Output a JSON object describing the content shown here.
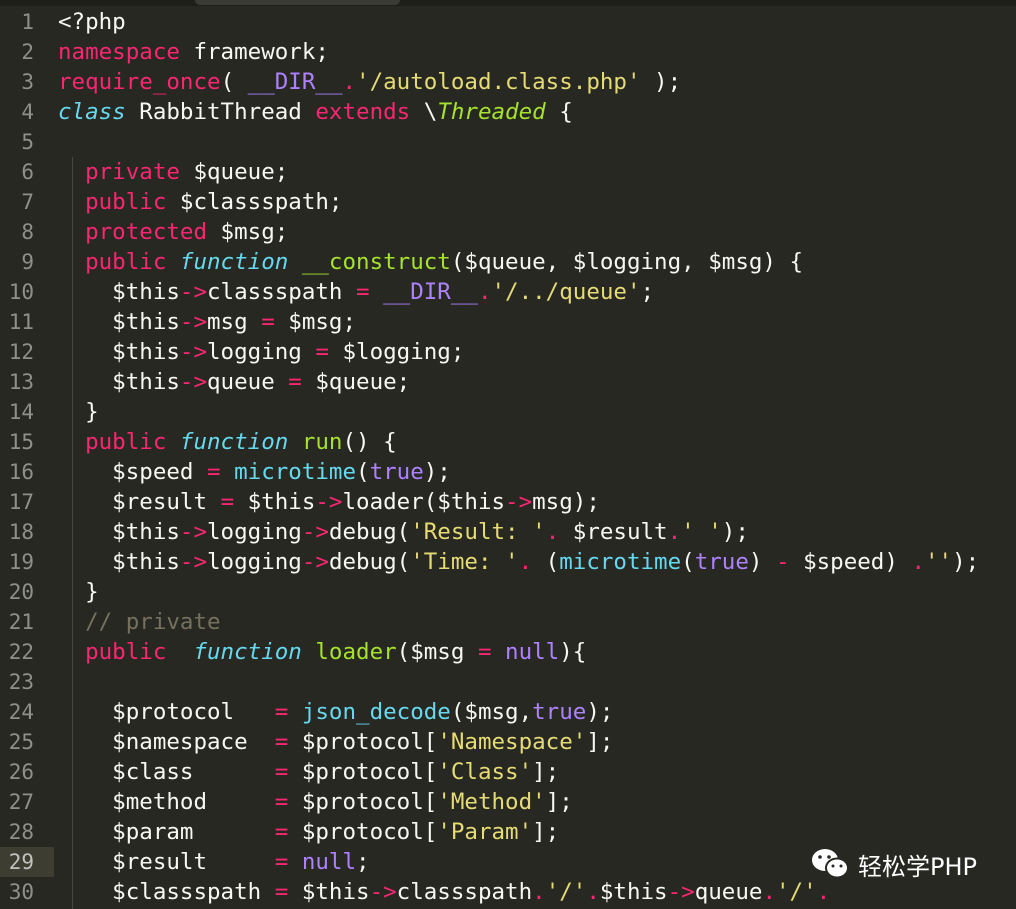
{
  "editor": {
    "theme_colors": {
      "background": "#272822",
      "keyword": "#f92672",
      "string": "#e6db74",
      "constant": "#ae81ff",
      "storage": "#66d9ef",
      "function": "#a6e22e",
      "comment": "#75715e"
    },
    "current_line": 29,
    "lines": [
      [
        [
          "p",
          "<?php"
        ]
      ],
      [
        [
          "k",
          "namespace"
        ],
        [
          "p",
          " framework;"
        ]
      ],
      [
        [
          "k",
          "require_once"
        ],
        [
          "p",
          "( "
        ],
        [
          "c",
          "__DIR__"
        ],
        [
          "k",
          "."
        ],
        [
          "s",
          "'/autoload.class.php'"
        ],
        [
          "p",
          " );"
        ]
      ],
      [
        [
          "i",
          "class"
        ],
        [
          "p",
          " RabbitThread "
        ],
        [
          "k",
          "extends"
        ],
        [
          "p",
          " \\"
        ],
        [
          "g",
          "Threaded"
        ],
        [
          "p",
          " {"
        ]
      ],
      [],
      [
        [
          "p",
          "  "
        ],
        [
          "k",
          "private"
        ],
        [
          "p",
          " $queue;"
        ]
      ],
      [
        [
          "p",
          "  "
        ],
        [
          "k",
          "public"
        ],
        [
          "p",
          " $classspath;"
        ]
      ],
      [
        [
          "p",
          "  "
        ],
        [
          "k",
          "protected"
        ],
        [
          "p",
          " $msg;"
        ]
      ],
      [
        [
          "p",
          "  "
        ],
        [
          "k",
          "public"
        ],
        [
          "p",
          " "
        ],
        [
          "i",
          "function"
        ],
        [
          "p",
          " "
        ],
        [
          "f",
          "__construct"
        ],
        [
          "p",
          "($queue, $logging, $msg) {"
        ]
      ],
      [
        [
          "p",
          "    $this"
        ],
        [
          "k",
          "->"
        ],
        [
          "p",
          "classspath "
        ],
        [
          "k",
          "="
        ],
        [
          "p",
          " "
        ],
        [
          "c",
          "__DIR__"
        ],
        [
          "k",
          "."
        ],
        [
          "s",
          "'/../queue'"
        ],
        [
          "p",
          ";"
        ]
      ],
      [
        [
          "p",
          "    $this"
        ],
        [
          "k",
          "->"
        ],
        [
          "p",
          "msg "
        ],
        [
          "k",
          "="
        ],
        [
          "p",
          " $msg;"
        ]
      ],
      [
        [
          "p",
          "    $this"
        ],
        [
          "k",
          "->"
        ],
        [
          "p",
          "logging "
        ],
        [
          "k",
          "="
        ],
        [
          "p",
          " $logging;"
        ]
      ],
      [
        [
          "p",
          "    $this"
        ],
        [
          "k",
          "->"
        ],
        [
          "p",
          "queue "
        ],
        [
          "k",
          "="
        ],
        [
          "p",
          " $queue;"
        ]
      ],
      [
        [
          "p",
          "  }"
        ]
      ],
      [
        [
          "p",
          "  "
        ],
        [
          "k",
          "public"
        ],
        [
          "p",
          " "
        ],
        [
          "i",
          "function"
        ],
        [
          "p",
          " "
        ],
        [
          "f",
          "run"
        ],
        [
          "p",
          "() {"
        ]
      ],
      [
        [
          "p",
          "    $speed "
        ],
        [
          "k",
          "="
        ],
        [
          "p",
          " "
        ],
        [
          "b",
          "microtime"
        ],
        [
          "p",
          "("
        ],
        [
          "c",
          "true"
        ],
        [
          "p",
          ");"
        ]
      ],
      [
        [
          "p",
          "    $result "
        ],
        [
          "k",
          "="
        ],
        [
          "p",
          " $this"
        ],
        [
          "k",
          "->"
        ],
        [
          "p",
          "loader($this"
        ],
        [
          "k",
          "->"
        ],
        [
          "p",
          "msg);"
        ]
      ],
      [
        [
          "p",
          "    $this"
        ],
        [
          "k",
          "->"
        ],
        [
          "p",
          "logging"
        ],
        [
          "k",
          "->"
        ],
        [
          "p",
          "debug("
        ],
        [
          "s",
          "'Result: '"
        ],
        [
          "k",
          "."
        ],
        [
          "p",
          " $result"
        ],
        [
          "k",
          "."
        ],
        [
          "s",
          "' '"
        ],
        [
          "p",
          ");"
        ]
      ],
      [
        [
          "p",
          "    $this"
        ],
        [
          "k",
          "->"
        ],
        [
          "p",
          "logging"
        ],
        [
          "k",
          "->"
        ],
        [
          "p",
          "debug("
        ],
        [
          "s",
          "'Time: '"
        ],
        [
          "k",
          "."
        ],
        [
          "p",
          " ("
        ],
        [
          "b",
          "microtime"
        ],
        [
          "p",
          "("
        ],
        [
          "c",
          "true"
        ],
        [
          "p",
          ") "
        ],
        [
          "k",
          "-"
        ],
        [
          "p",
          " $speed) "
        ],
        [
          "k",
          "."
        ],
        [
          "s",
          "''"
        ],
        [
          "p",
          ");"
        ]
      ],
      [
        [
          "p",
          "  }"
        ]
      ],
      [
        [
          "p",
          "  "
        ],
        [
          "m",
          "// private"
        ]
      ],
      [
        [
          "p",
          "  "
        ],
        [
          "k",
          "public"
        ],
        [
          "p",
          "  "
        ],
        [
          "i",
          "function"
        ],
        [
          "p",
          " "
        ],
        [
          "f",
          "loader"
        ],
        [
          "p",
          "($msg "
        ],
        [
          "k",
          "="
        ],
        [
          "p",
          " "
        ],
        [
          "c",
          "null"
        ],
        [
          "p",
          "){"
        ]
      ],
      [],
      [
        [
          "p",
          "    $protocol   "
        ],
        [
          "k",
          "="
        ],
        [
          "p",
          " "
        ],
        [
          "b",
          "json_decode"
        ],
        [
          "p",
          "($msg,"
        ],
        [
          "c",
          "true"
        ],
        [
          "p",
          ");"
        ]
      ],
      [
        [
          "p",
          "    $namespace  "
        ],
        [
          "k",
          "="
        ],
        [
          "p",
          " $protocol["
        ],
        [
          "s",
          "'Namespace'"
        ],
        [
          "p",
          "];"
        ]
      ],
      [
        [
          "p",
          "    $class      "
        ],
        [
          "k",
          "="
        ],
        [
          "p",
          " $protocol["
        ],
        [
          "s",
          "'Class'"
        ],
        [
          "p",
          "];"
        ]
      ],
      [
        [
          "p",
          "    $method     "
        ],
        [
          "k",
          "="
        ],
        [
          "p",
          " $protocol["
        ],
        [
          "s",
          "'Method'"
        ],
        [
          "p",
          "];"
        ]
      ],
      [
        [
          "p",
          "    $param      "
        ],
        [
          "k",
          "="
        ],
        [
          "p",
          " $protocol["
        ],
        [
          "s",
          "'Param'"
        ],
        [
          "p",
          "];"
        ]
      ],
      [
        [
          "p",
          "    $result     "
        ],
        [
          "k",
          "="
        ],
        [
          "p",
          " "
        ],
        [
          "c",
          "null"
        ],
        [
          "p",
          ";"
        ]
      ],
      [
        [
          "p",
          "    $classspath "
        ],
        [
          "k",
          "="
        ],
        [
          "p",
          " $this"
        ],
        [
          "k",
          "->"
        ],
        [
          "p",
          "classspath"
        ],
        [
          "k",
          "."
        ],
        [
          "s",
          "'/'"
        ],
        [
          "k",
          "."
        ],
        [
          "p",
          "$this"
        ],
        [
          "k",
          "->"
        ],
        [
          "p",
          "queue"
        ],
        [
          "k",
          "."
        ],
        [
          "s",
          "'/'"
        ],
        [
          "k",
          "."
        ]
      ]
    ]
  },
  "watermark": {
    "icon": "wechat-icon",
    "text": "轻松学PHP"
  }
}
